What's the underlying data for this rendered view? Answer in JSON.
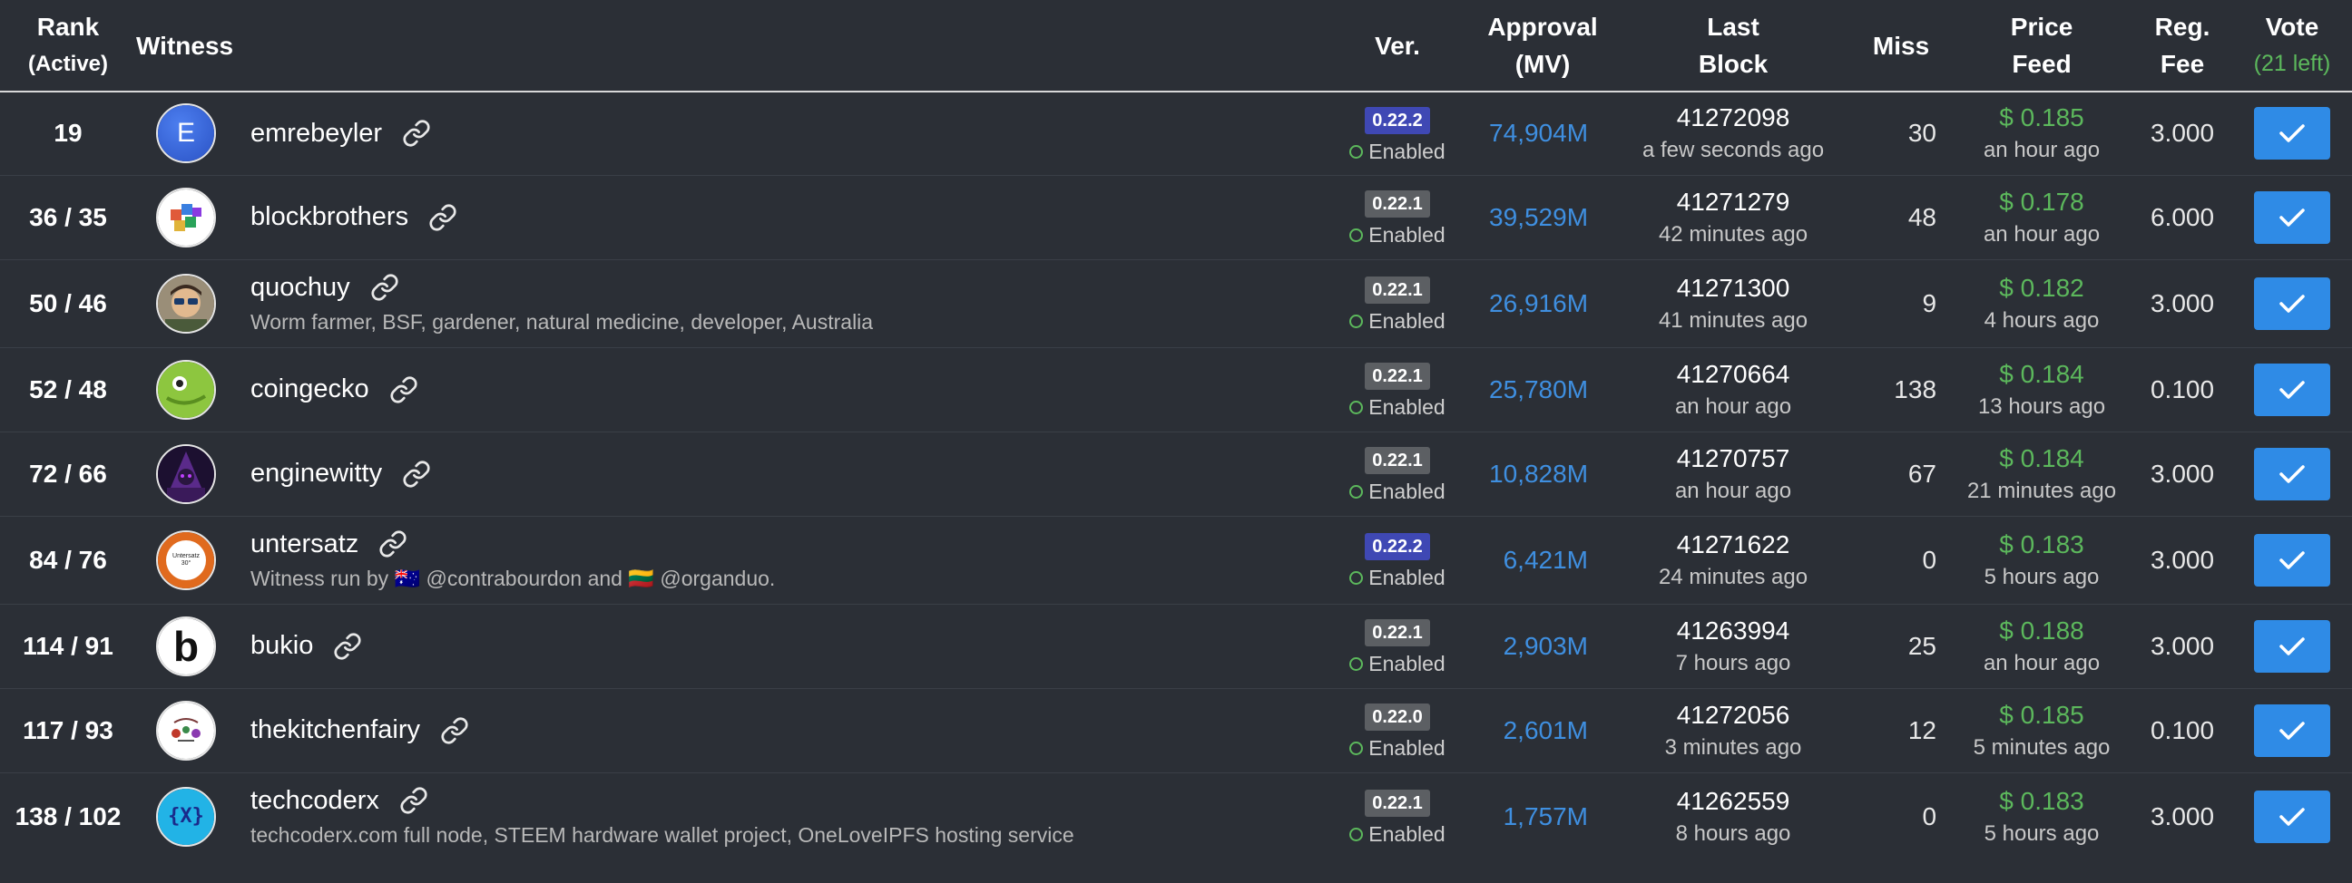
{
  "header": {
    "rank_line1": "Rank",
    "rank_line2": "(Active)",
    "witness": "Witness",
    "ver": "Ver.",
    "approval_line1": "Approval",
    "approval_line2": "(MV)",
    "last_line1": "Last",
    "last_line2": "Block",
    "miss": "Miss",
    "price_line1": "Price",
    "price_line2": "Feed",
    "fee_line1": "Reg.",
    "fee_line2": "Fee",
    "vote_line1": "Vote",
    "vote_line2": "(21 left)"
  },
  "rows": [
    {
      "rank": "19",
      "name": "emrebeyler",
      "desc": "",
      "ver": "0.22.2",
      "status": "Enabled",
      "approval": "74,904M",
      "block": "41272098",
      "block_time": "a few seconds ago",
      "miss": "30",
      "price": "$ 0.185",
      "price_time": "an hour ago",
      "fee": "3.000"
    },
    {
      "rank": "36 / 35",
      "name": "blockbrothers",
      "desc": "",
      "ver": "0.22.1",
      "status": "Enabled",
      "approval": "39,529M",
      "block": "41271279",
      "block_time": "42 minutes ago",
      "miss": "48",
      "price": "$ 0.178",
      "price_time": "an hour ago",
      "fee": "6.000"
    },
    {
      "rank": "50 / 46",
      "name": "quochuy",
      "desc": "Worm farmer, BSF, gardener, natural medicine, developer, Australia",
      "ver": "0.22.1",
      "status": "Enabled",
      "approval": "26,916M",
      "block": "41271300",
      "block_time": "41 minutes ago",
      "miss": "9",
      "price": "$ 0.182",
      "price_time": "4 hours ago",
      "fee": "3.000"
    },
    {
      "rank": "52 / 48",
      "name": "coingecko",
      "desc": "",
      "ver": "0.22.1",
      "status": "Enabled",
      "approval": "25,780M",
      "block": "41270664",
      "block_time": "an hour ago",
      "miss": "138",
      "price": "$ 0.184",
      "price_time": "13 hours ago",
      "fee": "0.100"
    },
    {
      "rank": "72 / 66",
      "name": "enginewitty",
      "desc": "",
      "ver": "0.22.1",
      "status": "Enabled",
      "approval": "10,828M",
      "block": "41270757",
      "block_time": "an hour ago",
      "miss": "67",
      "price": "$ 0.184",
      "price_time": "21 minutes ago",
      "fee": "3.000"
    },
    {
      "rank": "84 / 76",
      "name": "untersatz",
      "desc": "Witness run by 🇦🇺 @contrabourdon and 🇱🇹 @organduo.",
      "ver": "0.22.2",
      "status": "Enabled",
      "approval": "6,421M",
      "block": "41271622",
      "block_time": "24 minutes ago",
      "miss": "0",
      "price": "$ 0.183",
      "price_time": "5 hours ago",
      "fee": "3.000"
    },
    {
      "rank": "114 / 91",
      "name": "bukio",
      "desc": "",
      "ver": "0.22.1",
      "status": "Enabled",
      "approval": "2,903M",
      "block": "41263994",
      "block_time": "7 hours ago",
      "miss": "25",
      "price": "$ 0.188",
      "price_time": "an hour ago",
      "fee": "3.000"
    },
    {
      "rank": "117 / 93",
      "name": "thekitchenfairy",
      "desc": "",
      "ver": "0.22.0",
      "status": "Enabled",
      "approval": "2,601M",
      "block": "41272056",
      "block_time": "3 minutes ago",
      "miss": "12",
      "price": "$ 0.185",
      "price_time": "5 minutes ago",
      "fee": "0.100"
    },
    {
      "rank": "138 / 102",
      "name": "techcoderx",
      "desc": "techcoderx.com full node, STEEM hardware wallet project, OneLoveIPFS hosting service",
      "ver": "0.22.1",
      "status": "Enabled",
      "approval": "1,757M",
      "block": "41262559",
      "block_time": "8 hours ago",
      "miss": "0",
      "price": "$ 0.183",
      "price_time": "5 hours ago",
      "fee": "3.000"
    }
  ],
  "avatars": {
    "emrebeyler_letter": "E",
    "untersatz_text": "Untersatz",
    "untersatz_sub": "30°",
    "bukio_letter": "b",
    "techcoderx_text": "{X}"
  },
  "colors": {
    "background": "#2b2f36",
    "approval_blue": "#3f8fe0",
    "price_green": "#5cb85c",
    "vote_button": "#2f8be6",
    "badge_new": "#3f48b4",
    "badge_old": "#5c5f63"
  }
}
